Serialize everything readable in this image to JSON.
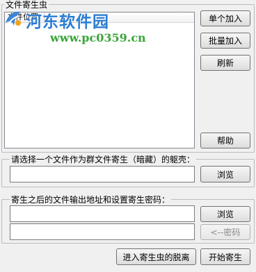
{
  "main_group": {
    "title": "文件寄生虫"
  },
  "file_list": {
    "column_header": "文件位置"
  },
  "buttons": {
    "add_single": "单个加入",
    "add_batch": "批量加入",
    "refresh": "刷新",
    "help": "帮助",
    "browse_host": "浏览",
    "browse_output": "浏览",
    "password": "<--密码",
    "detach": "进入寄生虫的脱离",
    "start": "开始寄生"
  },
  "host_group": {
    "title": "请选择一个文件作为群文件寄生（暗藏）的躯壳：",
    "value": ""
  },
  "output_group": {
    "title": "寄生之后的文件输出地址和设置寄生密码：",
    "output_value": "",
    "password_value": ""
  },
  "watermark": {
    "title": "河东软件园",
    "url": "www.pc0359.cn"
  },
  "colors": {
    "watermark_title": "#2b7cd3",
    "watermark_url": "#3aa53a",
    "window_bg": "#f0f0f0"
  }
}
